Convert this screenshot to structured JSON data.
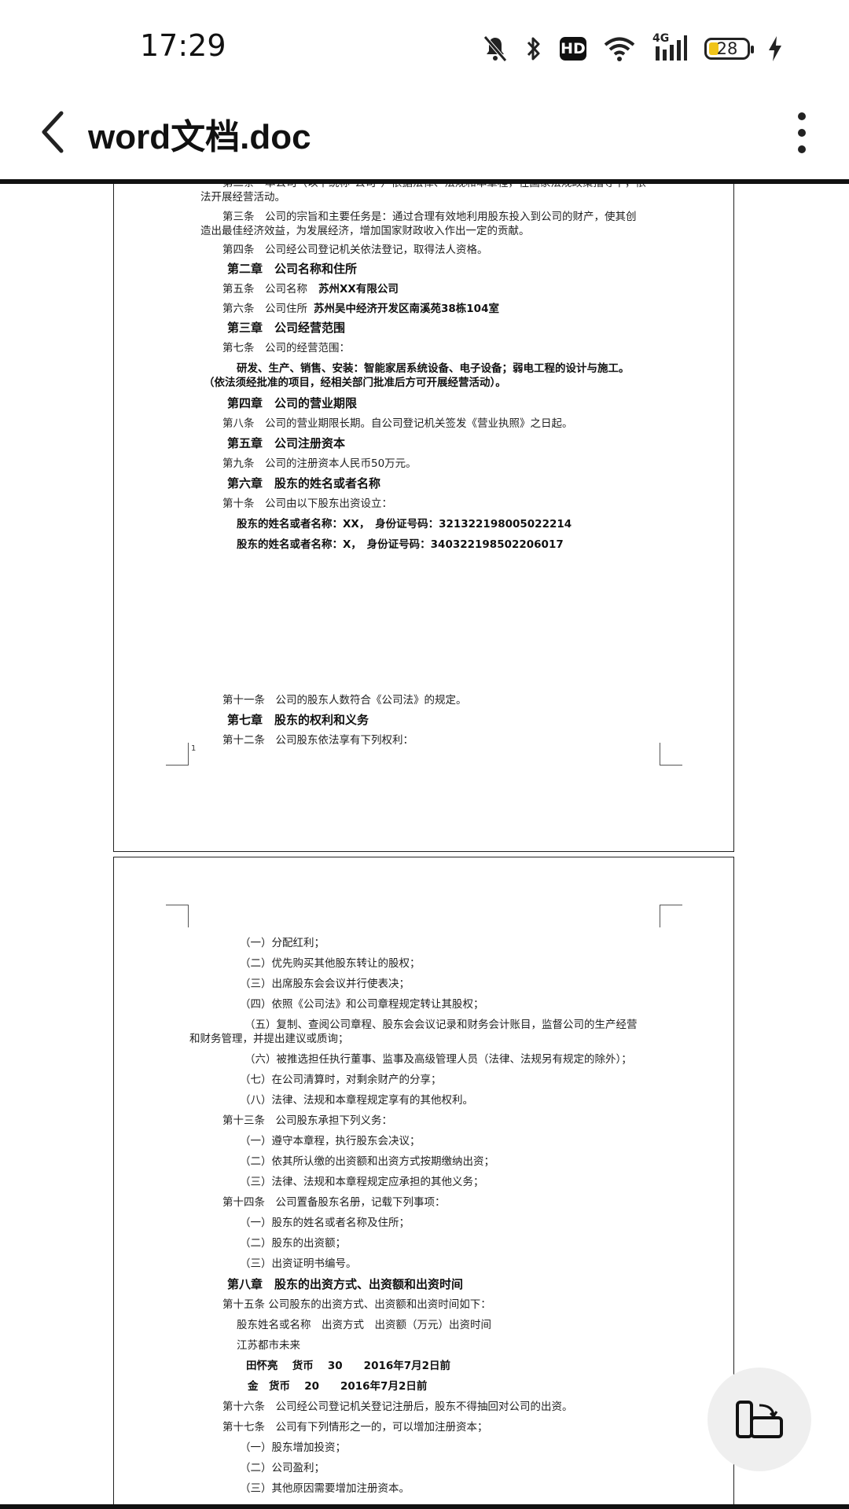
{
  "status": {
    "time": "17:29",
    "battery": "28",
    "network": "4G",
    "hd": "HD"
  },
  "appbar": {
    "title": "word文档.doc"
  },
  "page1": {
    "lines": [
      "第二条　本公司（以下统称\"公司\"）依据法律、法规和本章程，在国家法规政策指导下，依",
      "法开展经营活动。",
      "第三条　公司的宗旨和主要任务是：通过合理有效地利用股东投入到公司的财产，使其创",
      "造出最佳经济效益，为发展经济，增加国家财政收入作出一定的贡献。",
      "第四条　公司经公司登记机关依法登记，取得法人资格。",
      "第二章　公司名称和住所",
      "第五条　公司名称",
      "苏州XX有限公司",
      "第六条　公司住所",
      "苏州吴中经济开发区南溪苑38栋104室",
      "第三章　公司经营范围",
      "第七条　公司的经营范围：",
      "研发、生产、销售、安装：智能家居系统设备、电子设备；弱电工程的设计与施工。",
      "（依法须经批准的项目，经相关部门批准后方可开展经营活动）。",
      "第四章　公司的营业期限",
      "第八条　公司的营业期限长期。自公司登记机关签发《营业执照》之日起。",
      "第五章　公司注册资本",
      "第九条　公司的注册资本人民币50万元。",
      "第六章　股东的姓名或者名称",
      "第十条　公司由以下股东出资设立：",
      "股东的姓名或者名称：XX，　身份证号码：321322198005022214",
      "股东的姓名或者名称：X，　身份证号码：340322198502206017",
      "第十一条　公司的股东人数符合《公司法》的规定。",
      "第七章　股东的权利和义务",
      "第十二条　公司股东依法享有下列权利："
    ],
    "page_number": "1"
  },
  "page2": {
    "lines": [
      "（一）分配红利；",
      "（二）优先购买其他股东转让的股权；",
      "（三）出席股东会会议并行使表决；",
      "（四）依照《公司法》和公司章程规定转让其股权；",
      "（五）复制、查阅公司章程、股东会会议记录和财务会计账目，监督公司的生产经营",
      "和财务管理，并提出建议或质询；",
      "（六）被推选担任执行董事、监事及高级管理人员（法律、法规另有规定的除外）；",
      "（七）在公司清算时，对剩余财产的分享；",
      "（八）法律、法规和本章程规定享有的其他权利。",
      "第十三条　公司股东承担下列义务：",
      "（一）遵守本章程，执行股东会决议；",
      "（二）依其所认缴的出资额和出资方式按期缴纳出资；",
      "（三）法律、法规和本章程规定应承担的其他义务；",
      "第十四条　公司置备股东名册，记载下列事项：",
      "（一）股东的姓名或者名称及住所；",
      "（二）股东的出资额；",
      "（三）出资证明书编号。",
      "第八章　股东的出资方式、出资额和出资时间",
      "第十五条 公司股东的出资方式、出资额和出资时间如下：",
      "股东姓名或名称　出资方式　出资额（万元）出资时间",
      "江苏都市未来",
      "田怀亮　 货币　 30　　2016年7月2日前",
      "金　货币　 20　　2016年7月2日前",
      "第十六条　公司经公司登记机关登记注册后，股东不得抽回对公司的出资。",
      "第十七条　公司有下列情形之一的，可以增加注册资本；",
      "（一）股东增加投资；",
      "（二）公司盈利；",
      "（三）其他原因需要增加注册资本。"
    ]
  },
  "icons": {
    "back": "back-arrow-icon",
    "menu": "more-vertical-icon",
    "fab": "rotate-screen-icon",
    "mute": "bell-off-icon",
    "bluetooth": "bluetooth-icon",
    "wifi": "wifi-icon",
    "signal": "signal-icon",
    "charging": "charging-bolt-icon"
  },
  "colors": {
    "battery_fill": "#f0c419",
    "text": "#111111",
    "fab_bg": "#efefef"
  }
}
